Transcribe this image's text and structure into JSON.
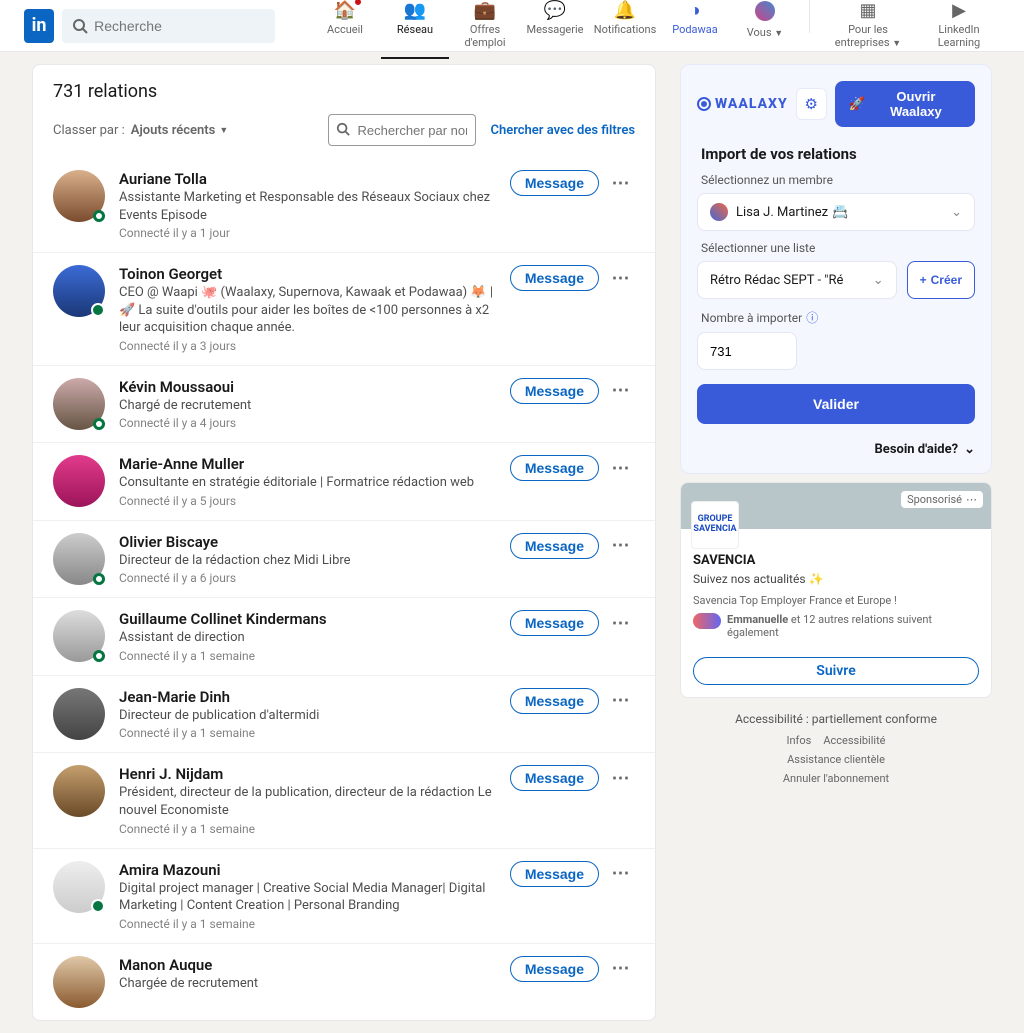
{
  "nav": {
    "search_placeholder": "Recherche",
    "items": [
      {
        "label": "Accueil"
      },
      {
        "label": "Réseau"
      },
      {
        "label": "Offres d'emploi"
      },
      {
        "label": "Messagerie"
      },
      {
        "label": "Notifications"
      },
      {
        "label": "Podawaa"
      },
      {
        "label": "Vous"
      }
    ],
    "extra": [
      {
        "label": "Pour les entreprises"
      },
      {
        "label": "LinkedIn Learning"
      }
    ]
  },
  "connections": {
    "title": "731 relations",
    "sort_label": "Classer par :",
    "sort_value": "Ajouts récents",
    "search_placeholder": "Rechercher par nom",
    "filters_link": "Chercher avec des filtres",
    "message_label": "Message",
    "list": [
      {
        "name": "Auriane Tolla",
        "sub": "Assistante Marketing et Responsable des Réseaux Sociaux chez Events Episode",
        "meta": "Connecté il y a 1 jour",
        "presence": "offline"
      },
      {
        "name": "Toinon Georget",
        "sub": "CEO @ Waapi 🐙 (Waalaxy, Supernova, Kawaak et Podawaa) 🦊 | 🚀 La suite d'outils pour aider les boîtes de <100 personnes à x2 leur acquisition chaque année.",
        "meta": "Connecté il y a 3 jours",
        "presence": "online"
      },
      {
        "name": "Kévin Moussaoui",
        "sub": "Chargé de recrutement",
        "meta": "Connecté il y a 4 jours",
        "presence": "offline"
      },
      {
        "name": "Marie-Anne Muller",
        "sub": "Consultante en stratégie éditoriale | Formatrice rédaction web",
        "meta": "Connecté il y a 5 jours",
        "presence": ""
      },
      {
        "name": "Olivier Biscaye",
        "sub": "Directeur de la rédaction chez Midi Libre",
        "meta": "Connecté il y a 6 jours",
        "presence": "offline"
      },
      {
        "name": "Guillaume Collinet Kindermans",
        "sub": "Assistant de direction",
        "meta": "Connecté il y a 1 semaine",
        "presence": "offline"
      },
      {
        "name": "Jean-Marie Dinh",
        "sub": "Directeur de publication d'altermidi",
        "meta": "Connecté il y a 1 semaine",
        "presence": ""
      },
      {
        "name": "Henri J. Nijdam",
        "sub": "Président, directeur de la publication, directeur de la rédaction Le nouvel Economiste",
        "meta": "Connecté il y a 1 semaine",
        "presence": ""
      },
      {
        "name": "Amira Mazouni",
        "sub": "Digital project manager | Creative Social Media Manager| Digital Marketing | Content Creation | Personal Branding",
        "meta": "Connecté il y a 1 semaine",
        "presence": "online"
      },
      {
        "name": "Manon Auque",
        "sub": "Chargée de recrutement",
        "meta": "",
        "presence": ""
      }
    ]
  },
  "waalaxy": {
    "brand": "WAALAXY",
    "open_label": "Ouvrir Waalaxy",
    "import_title": "Import de vos relations",
    "member_label": "Sélectionnez un membre",
    "member_value": "Lisa J. Martinez",
    "list_label": "Sélectionner une liste",
    "list_value": "Rétro Rédac SEPT - \"Ré",
    "create_label": "Créer",
    "count_label": "Nombre à importer",
    "count_value": "731",
    "validate_label": "Valider",
    "help_label": "Besoin d'aide?"
  },
  "sponsored": {
    "badge": "Sponsorisé",
    "logo_text": "GROUPE SAVENCIA",
    "name": "SAVENCIA",
    "tagline": "Suivez nos actualités ✨",
    "note": "Savencia Top Employer France et Europe !",
    "friends_prefix": "Emmanuelle",
    "friends_suffix": " et 12 autres relations suivent également",
    "follow_label": "Suivre"
  },
  "footer": {
    "title": "Accessibilité : partiellement conforme",
    "links": [
      "Infos",
      "Accessibilité",
      "Assistance clientèle",
      "Annuler l'abonnement"
    ]
  }
}
